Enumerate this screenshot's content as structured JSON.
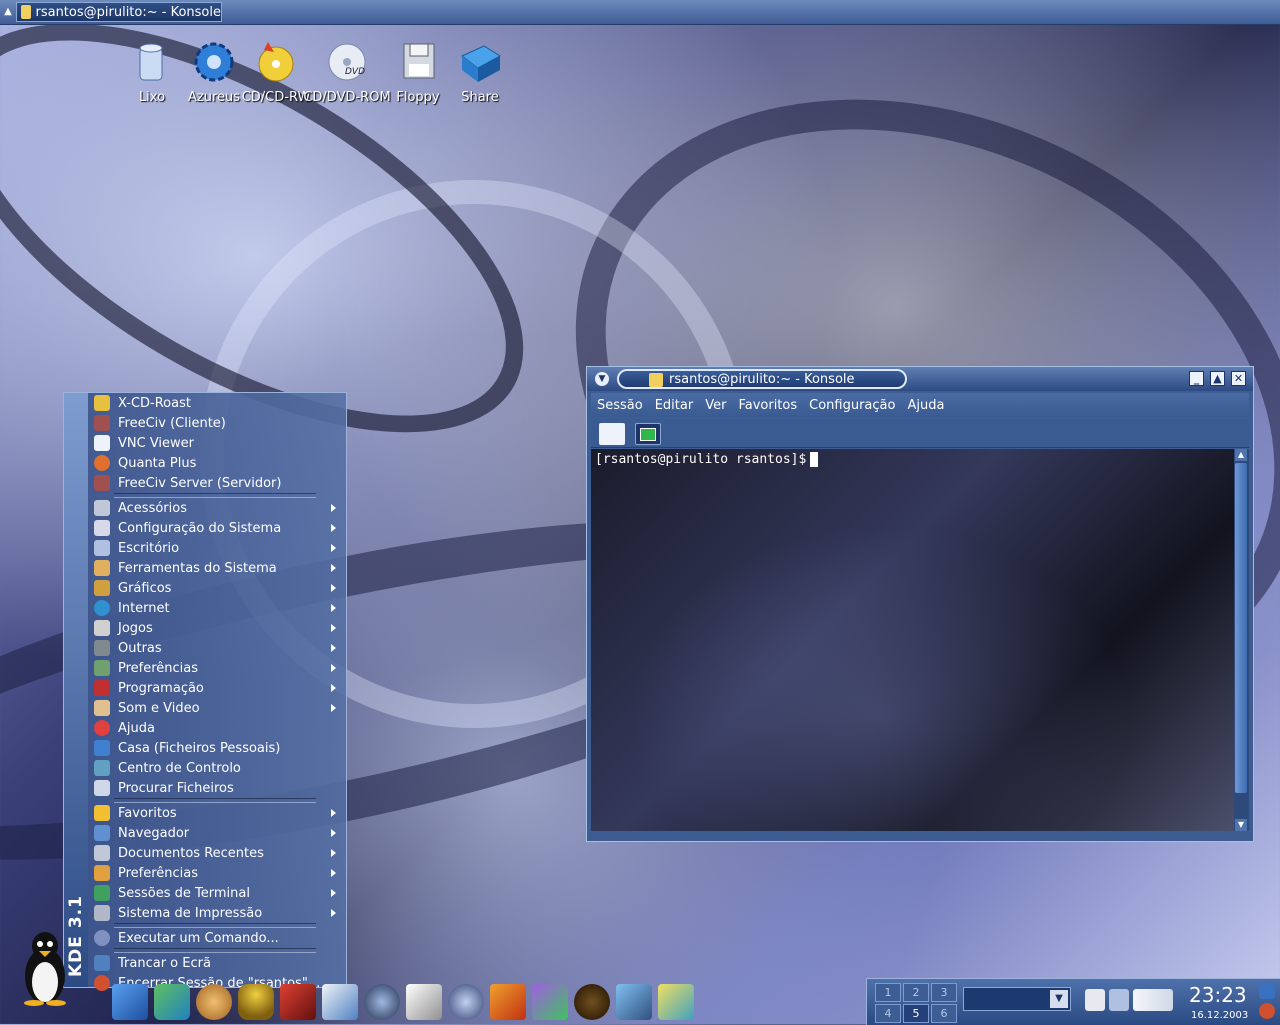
{
  "top_taskbar": {
    "task_title": "rsantos@pirulito:~ - Konsole"
  },
  "desktop_icons": [
    {
      "label": "Lixo",
      "icon": "trash-icon"
    },
    {
      "label": "Azureus",
      "icon": "gear-icon"
    },
    {
      "label": "CD/CD-RW",
      "icon": "cd-burner-icon"
    },
    {
      "label": "CD/DVD-ROM",
      "icon": "dvd-icon"
    },
    {
      "label": "Floppy",
      "icon": "floppy-icon"
    },
    {
      "label": "Share",
      "icon": "shared-folder-icon"
    }
  ],
  "kmenu": {
    "side_label": "KDE 3.1",
    "recent_apps": [
      "X-CD-Roast",
      "FreeCiv (Cliente)",
      "VNC Viewer",
      "Quanta Plus",
      "FreeCiv Server (Servidor)"
    ],
    "categories": [
      "Acessórios",
      "Configuração do Sistema",
      "Escritório",
      "Ferramentas do Sistema",
      "Gráficos",
      "Internet",
      "Jogos",
      "Outras",
      "Preferências",
      "Programação",
      "Som e Video"
    ],
    "system_items": [
      "Ajuda",
      "Casa (Ficheiros Pessoais)",
      "Centro de Controlo",
      "Procurar Ficheiros"
    ],
    "submenus": [
      "Favoritos",
      "Navegador",
      "Documentos Recentes",
      "Preferências",
      "Sessões de Terminal",
      "Sistema de Impressão"
    ],
    "run_command": "Executar um Comando...",
    "lock_screen": "Trancar o Ecrã",
    "logout": "Encerrar Sessão de \"rsantos\"..."
  },
  "konsole": {
    "title": "rsantos@pirulito:~ - Konsole",
    "menu": [
      "Sessão",
      "Editar",
      "Ver",
      "Favoritos",
      "Configuração",
      "Ajuda"
    ],
    "prompt": "[rsantos@pirulito rsantos]$"
  },
  "tray": {
    "desktops": [
      "1",
      "2",
      "3",
      "4",
      "5",
      "6"
    ],
    "active_desktop": "5",
    "time": "23:23",
    "date": "16.12.2003"
  }
}
